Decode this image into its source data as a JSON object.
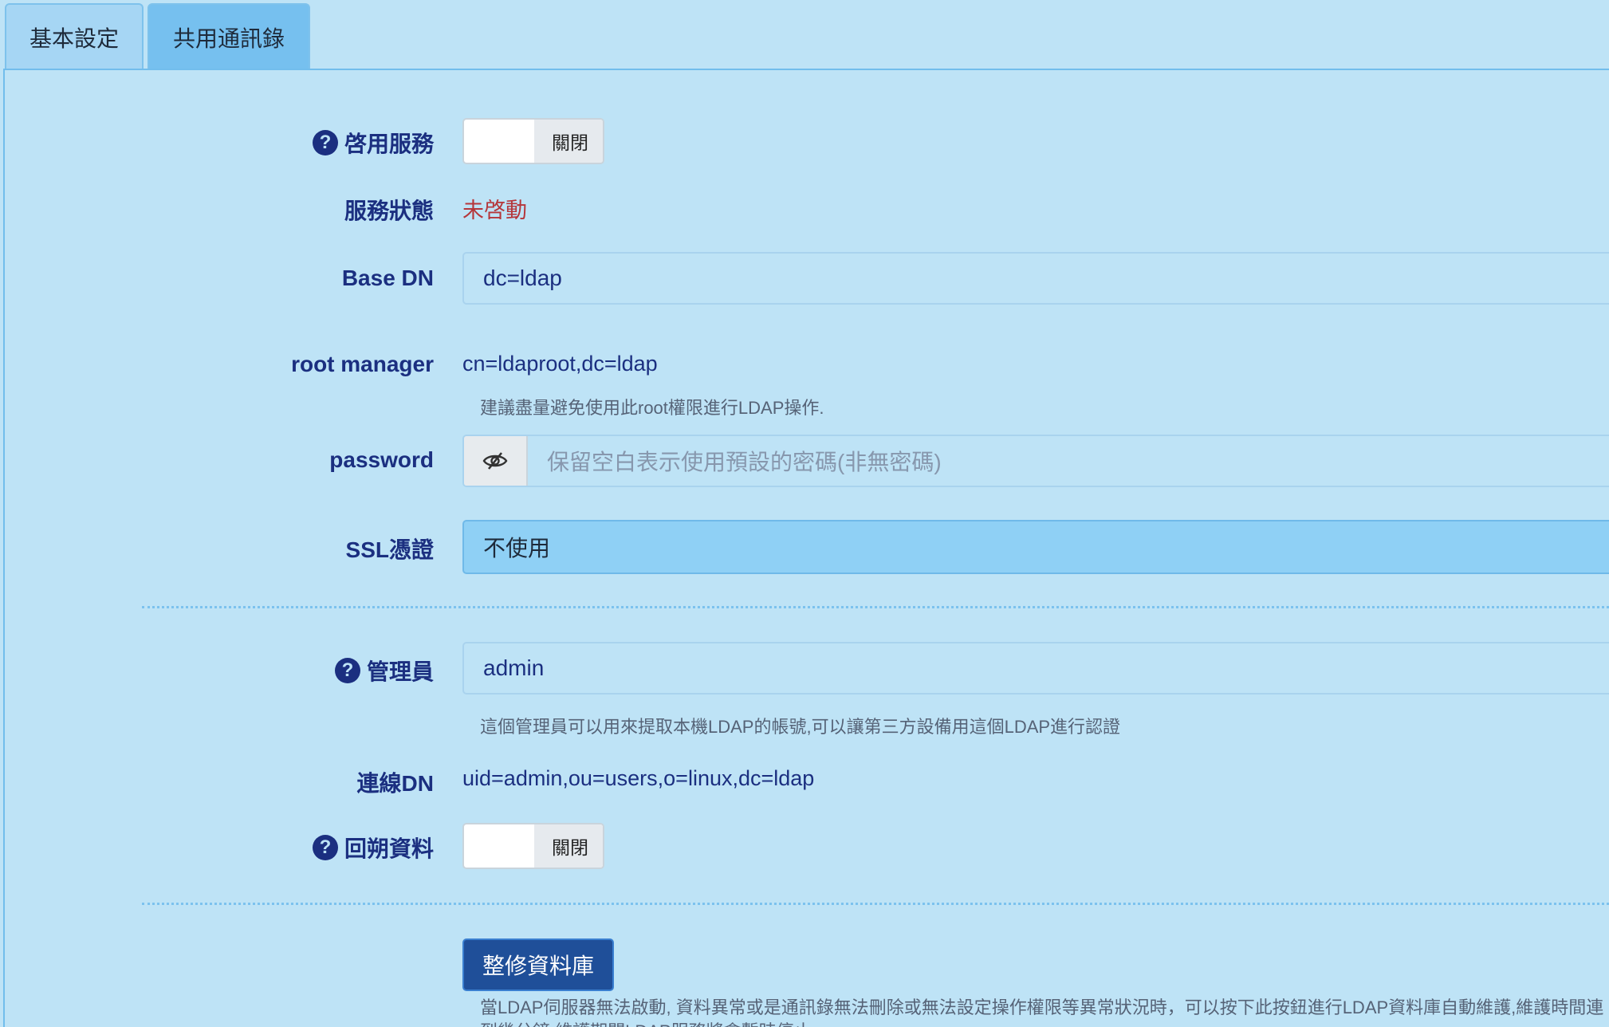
{
  "tabs": [
    {
      "label": "基本設定"
    },
    {
      "label": "共用通訊錄"
    }
  ],
  "form": {
    "enable_service": {
      "label": "啓用服務",
      "toggle_text": "關閉"
    },
    "service_status": {
      "label": "服務狀態",
      "value": "未啓動"
    },
    "base_dn": {
      "label": "Base DN",
      "value": "dc=ldap"
    },
    "root_manager": {
      "label": "root manager",
      "value": "cn=ldaproot,dc=ldap",
      "hint": "建議盡量避免使用此root權限進行LDAP操作."
    },
    "password": {
      "label": "password",
      "placeholder": "保留空白表示使用預設的密碼(非無密碼)"
    },
    "ssl_cert": {
      "label": "SSL憑證",
      "selected": "不使用"
    },
    "admin": {
      "label": "管理員",
      "value": "admin",
      "hint": "這個管理員可以用來提取本機LDAP的帳號,可以讓第三方設備用這個LDAP進行認證"
    },
    "connection_dn": {
      "label": "連線DN",
      "value": "uid=admin,ou=users,o=linux,dc=ldap"
    },
    "rollback": {
      "label": "回朔資料",
      "toggle_text": "關閉"
    },
    "repair_button": {
      "label": "整修資料庫"
    },
    "repair_hint_line1": "當LDAP伺服器無法啟動, 資料異常或是通訊錄無法刪除或無法設定操作權限等異常狀況時，可以按下此按鈕進行LDAP資料庫自動維護,維護時間連",
    "repair_hint_line2": "到幾分鐘,維護期間LDAP服務將會暫時停止."
  },
  "icons": {
    "help": "question-circle-icon",
    "password_toggle": "eye-slash-icon"
  },
  "colors": {
    "background": "#bee3f6",
    "label": "#1b2f80",
    "status_inactive": "#b5363a",
    "primary_button": "#1f4f99"
  }
}
